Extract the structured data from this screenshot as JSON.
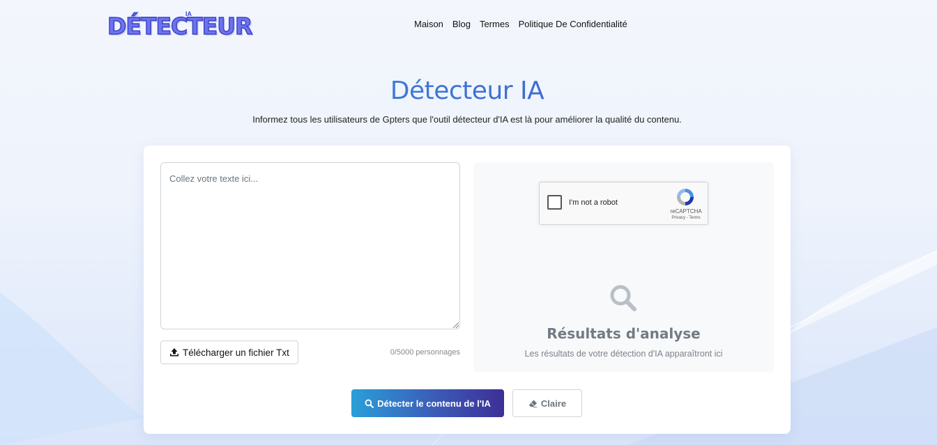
{
  "brand": {
    "logo_text": "DÉTECTEUR",
    "logo_superscript": "IA"
  },
  "nav": {
    "items": [
      "Maison",
      "Blog",
      "Termes",
      "Politique De Confidentialité"
    ]
  },
  "hero": {
    "title": "Détecteur IA",
    "subtitle": "Informez tous les utilisateurs de Gpters que l'outil détecteur d'IA est là pour améliorer la qualité du contenu."
  },
  "input": {
    "placeholder": "Collez votre texte ici...",
    "value": "",
    "upload_label": "Télécharger un fichier Txt",
    "char_count": "0/5000 personnages"
  },
  "recaptcha": {
    "label": "I'm not a robot",
    "brand": "reCAPTCHA",
    "links": "Privacy - Terms",
    "checked": false
  },
  "results": {
    "title": "Résultats d'analyse",
    "subtitle": "Les résultats de votre détection d'IA apparaîtront ici"
  },
  "actions": {
    "detect_label": "Détecter le contenu de l'IA",
    "clear_label": "Claire"
  },
  "colors": {
    "accent_start": "#2a9fd8",
    "accent_end": "#3d2f96",
    "title_gradient_start": "#1fb7e3",
    "title_gradient_end": "#3f49c0",
    "logo": "#6d73ef"
  },
  "icons": {
    "upload": "upload-icon",
    "search": "search-icon",
    "eraser": "eraser-icon",
    "recaptcha": "recaptcha-logo-icon"
  }
}
